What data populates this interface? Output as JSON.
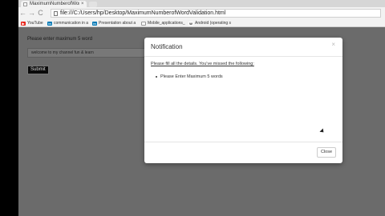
{
  "browser": {
    "tab_title": "MaximumNumberofWor",
    "tab_close": "×",
    "url": "file:///C:/Users/hp/Desktop/MaximumNumberofWordValidation.html",
    "nav": {
      "back": "←",
      "forward": "→",
      "reload": "C"
    }
  },
  "bookmarks": [
    {
      "icon": "youtube-icon",
      "label": "YouTube",
      "color": "#e62117",
      "mark": "▶"
    },
    {
      "icon": "linkedin-icon",
      "label": "communication in a",
      "color": "#0077b5",
      "mark": "in"
    },
    {
      "icon": "linkedin-icon",
      "label": "Presentation about a",
      "color": "#0077b5",
      "mark": "in"
    },
    {
      "icon": "page-icon",
      "label": "Mobile_applications_",
      "color": "#ffffff",
      "mark": ""
    },
    {
      "icon": "wikipedia-icon",
      "label": "Android (operating s",
      "color": "#ffffff",
      "mark": "W"
    }
  ],
  "page": {
    "label": "Please enter maximum 5 word",
    "input_value": "welcome to my channel fun & learn",
    "submit_label": "Submit"
  },
  "modal": {
    "title": "Notification",
    "close_x": "×",
    "message": "Please fill all the details. You've missed the following:",
    "errors": [
      "Please Enter Maximum 5 words"
    ],
    "close_label": "Close"
  }
}
